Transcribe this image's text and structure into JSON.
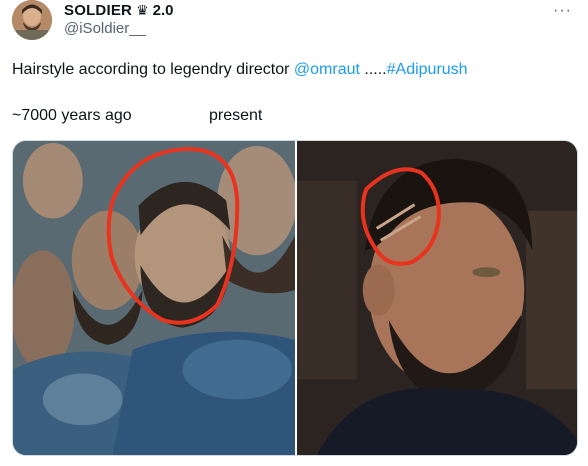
{
  "author": {
    "display_name": "SOLDIER",
    "badge_icon": "crown-icon",
    "badge_glyph": "♛",
    "name_suffix": "2.0",
    "handle": "@iSoldier__"
  },
  "more_icon_glyph": "···",
  "tweet": {
    "text_prefix": "Hairstyle according to legendry director ",
    "mention": "@omraut",
    "text_mid": " .....",
    "hashtag": "#Adipurush"
  },
  "comparison": {
    "left_caption": "~7000 years ago",
    "right_caption": "present"
  },
  "colors": {
    "link": "#1d9bf0",
    "handle": "#536471",
    "annotation_circle": "#e8331f"
  },
  "media": {
    "left_panel_subject": "movie-still-bearded-warriors",
    "right_panel_subject": "man-with-shaved-line-hairstyle"
  }
}
